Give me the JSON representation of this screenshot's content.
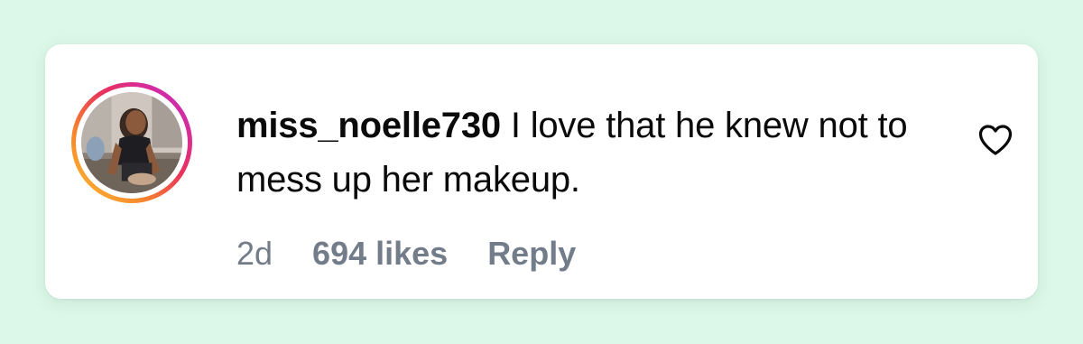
{
  "comment": {
    "username": "miss_noelle730",
    "text": "I love that he knew not to mess up her makeup.",
    "time": "2d",
    "likes": "694 likes",
    "reply_label": "Reply"
  },
  "icons": {
    "like": "heart-outline-icon",
    "avatar_ring": "story-gradient-ring"
  },
  "colors": {
    "background": "#dcf8e8",
    "card": "#ffffff",
    "text": "#0a0a0a",
    "meta_text": "#737d8a"
  }
}
